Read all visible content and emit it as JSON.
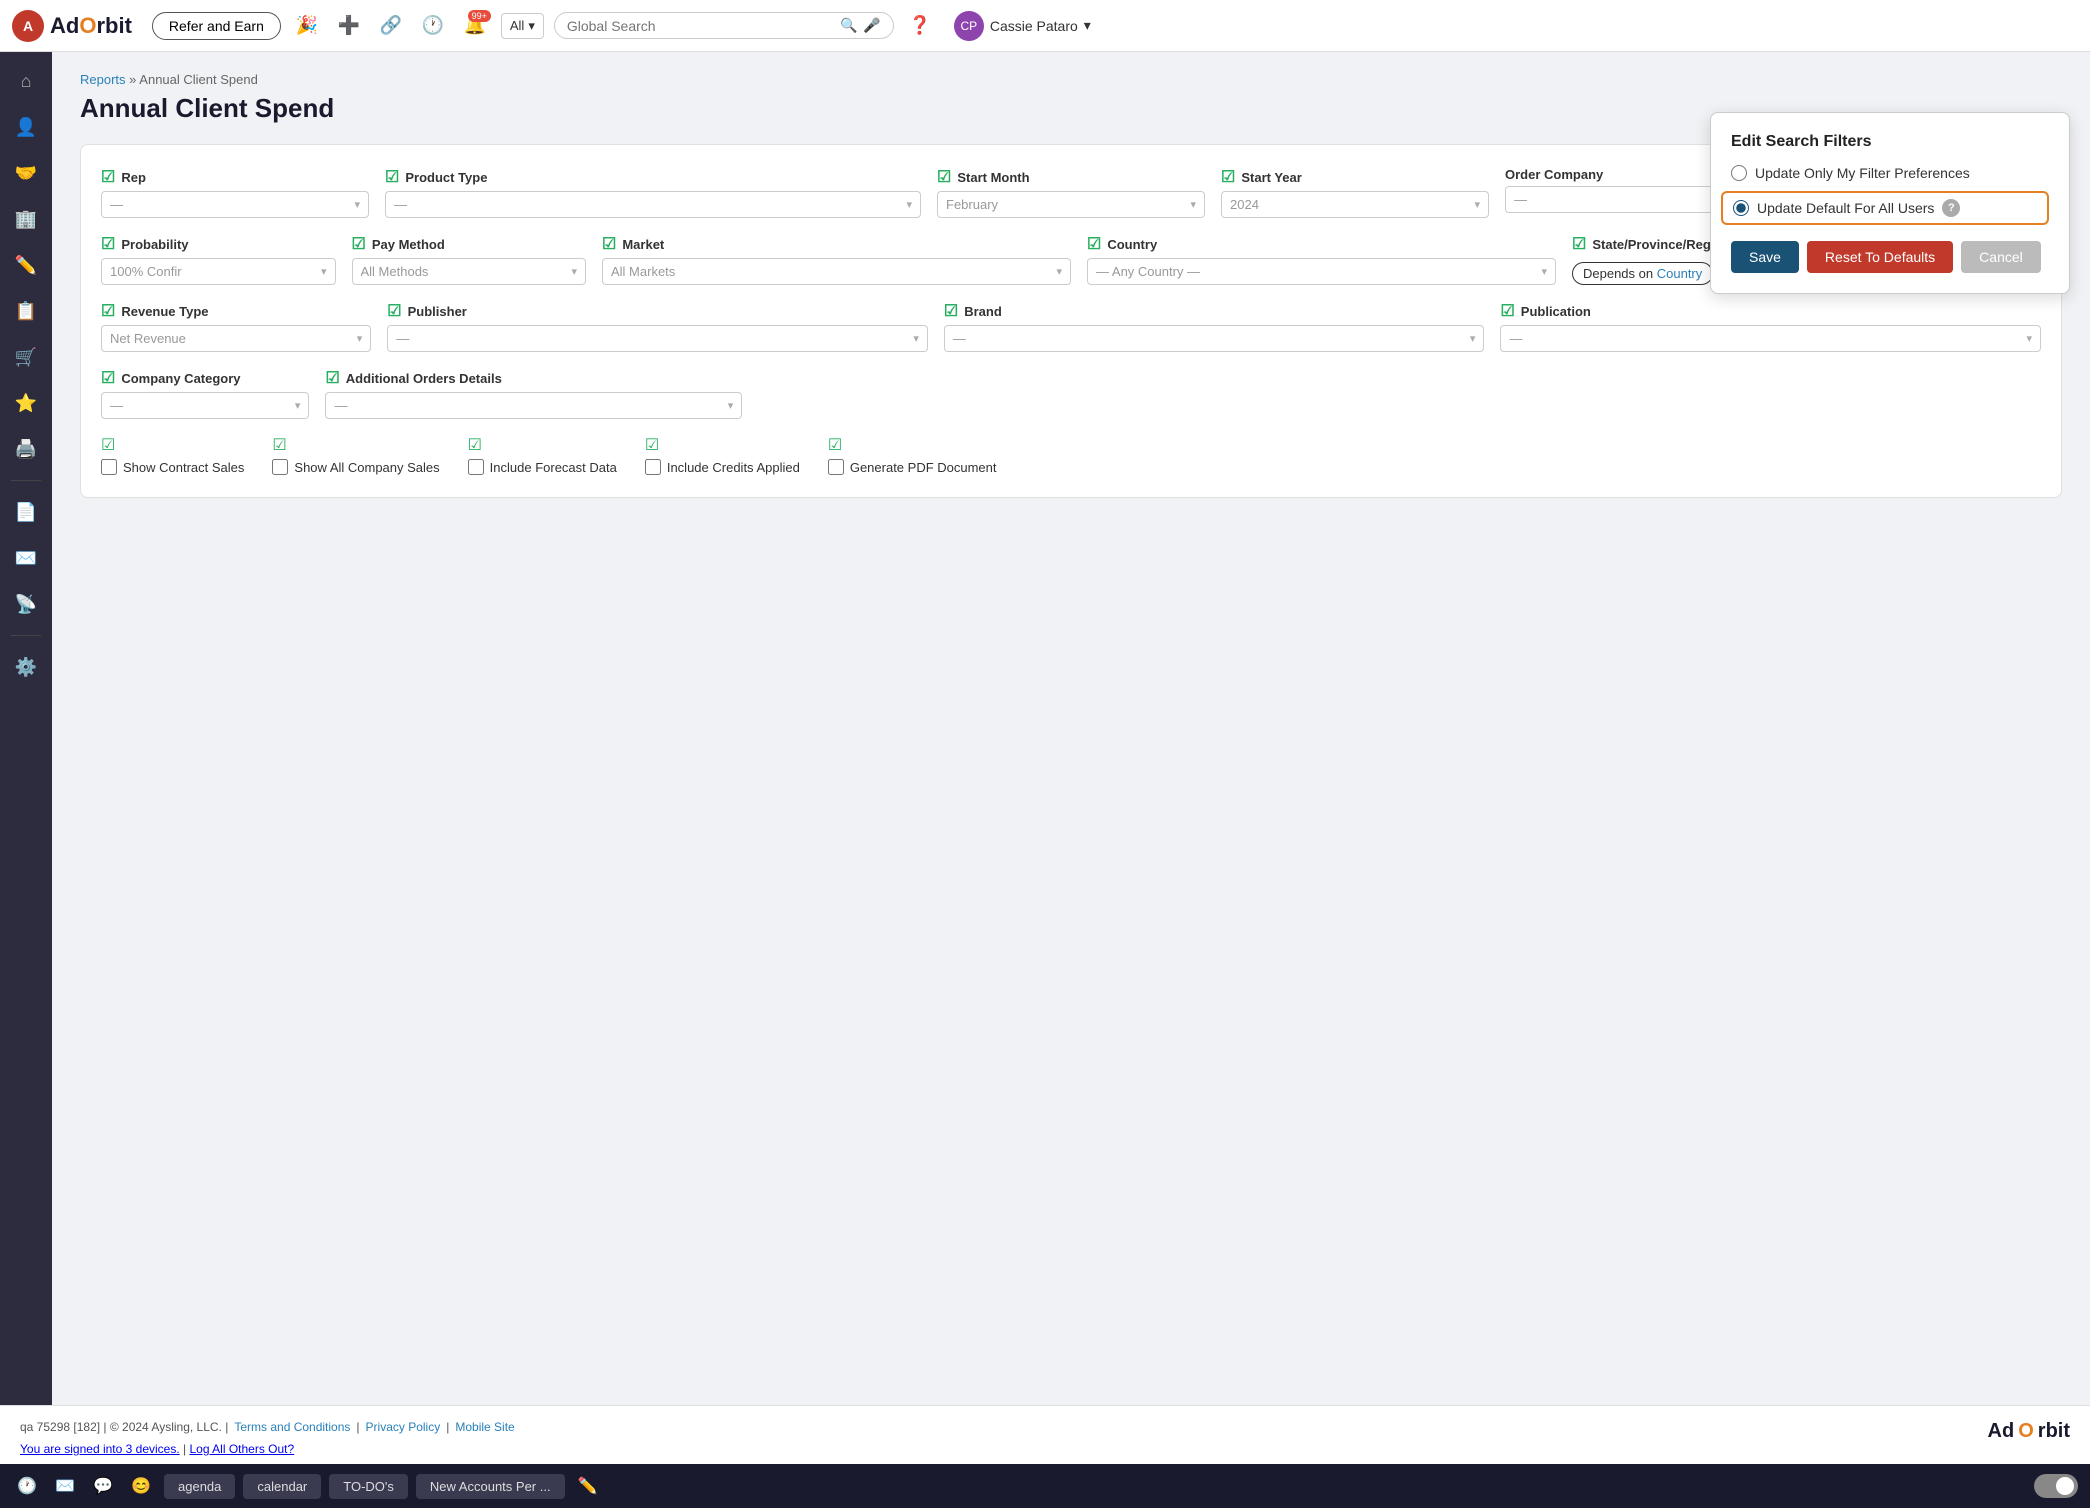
{
  "app": {
    "logo_text_1": "Ad",
    "logo_text_2": "rbit",
    "logo_dot": "O"
  },
  "topbar": {
    "refer_btn": "Refer and Earn",
    "all_label": "All",
    "search_placeholder": "Global Search",
    "user_name": "Cassie Pataro",
    "notif_count": "99+"
  },
  "breadcrumb": {
    "parent": "Reports",
    "separator": "»",
    "current": "Annual Client Spend"
  },
  "page": {
    "title": "Annual Client Spend"
  },
  "filters": {
    "rep_label": "Rep",
    "rep_value": "—",
    "product_type_label": "Product Type",
    "product_type_value": "—",
    "start_month_label": "Start Month",
    "start_month_value": "February",
    "start_year_label": "Start Year",
    "start_year_value": "2024",
    "order_company_label": "Order Company",
    "order_company_value": "—",
    "probability_label": "Probability",
    "probability_value": "100% Confir",
    "pay_method_label": "Pay Method",
    "pay_method_value": "All Methods",
    "market_label": "Market",
    "market_value": "All Markets",
    "country_label": "Country",
    "country_value": "— Any Country —",
    "state_label": "State/Province/Region",
    "state_value": "Depends on Country",
    "revenue_type_label": "Revenue Type",
    "revenue_type_value": "Net Revenue",
    "publisher_label": "Publisher",
    "publisher_value": "—",
    "brand_label": "Brand",
    "brand_value": "—",
    "publication_label": "Publication",
    "publication_value": "—",
    "company_category_label": "Company Category",
    "company_category_value": "—",
    "additional_orders_label": "Additional Orders Details",
    "additional_orders_value": "—"
  },
  "checkboxes": [
    {
      "id": "show_contract",
      "label": "Show Contract Sales",
      "checked": false
    },
    {
      "id": "show_all_company",
      "label": "Show All Company Sales",
      "checked": false
    },
    {
      "id": "include_forecast",
      "label": "Include Forecast Data",
      "checked": false
    },
    {
      "id": "include_credits",
      "label": "Include Credits Applied",
      "checked": false
    },
    {
      "id": "generate_pdf",
      "label": "Generate PDF Document",
      "checked": false
    }
  ],
  "modal": {
    "title": "Edit Search Filters",
    "option1": "Update Only My Filter Preferences",
    "option2": "Update Default For All Users",
    "help_icon": "?",
    "btn_save": "Save",
    "btn_reset": "Reset To Defaults",
    "btn_cancel": "Cancel",
    "selected_option": "option2",
    "depends_text": "Depends on",
    "depends_link": "Country"
  },
  "footer": {
    "info": "qa 75298 [182] | © 2024 Aysling, LLC. |",
    "terms": "Terms and Conditions",
    "privacy": "Privacy Policy",
    "mobile": "Mobile Site",
    "signed_in": "You are signed into 3 devices.",
    "log_out": "Log All Others Out?",
    "logo_text_1": "Ad",
    "logo_text_2": "rbit"
  },
  "taskbar": {
    "agenda_btn": "agenda",
    "calendar_btn": "calendar",
    "todo_btn": "TO-DO's",
    "new_accounts_btn": "New Accounts Per ..."
  },
  "sidebar": {
    "items": [
      {
        "icon": "⌂",
        "name": "home"
      },
      {
        "icon": "👤",
        "name": "contacts"
      },
      {
        "icon": "🤝",
        "name": "deals"
      },
      {
        "icon": "🏢",
        "name": "companies"
      },
      {
        "icon": "✏️",
        "name": "edit"
      },
      {
        "icon": "📋",
        "name": "orders"
      },
      {
        "icon": "🛒",
        "name": "cart"
      },
      {
        "icon": "⭐",
        "name": "favorites"
      },
      {
        "icon": "🖨️",
        "name": "print"
      },
      {
        "icon": "📄",
        "name": "documents"
      },
      {
        "icon": "✉️",
        "name": "mail"
      },
      {
        "icon": "📡",
        "name": "reports-active"
      },
      {
        "icon": "⚙️",
        "name": "settings"
      }
    ]
  }
}
